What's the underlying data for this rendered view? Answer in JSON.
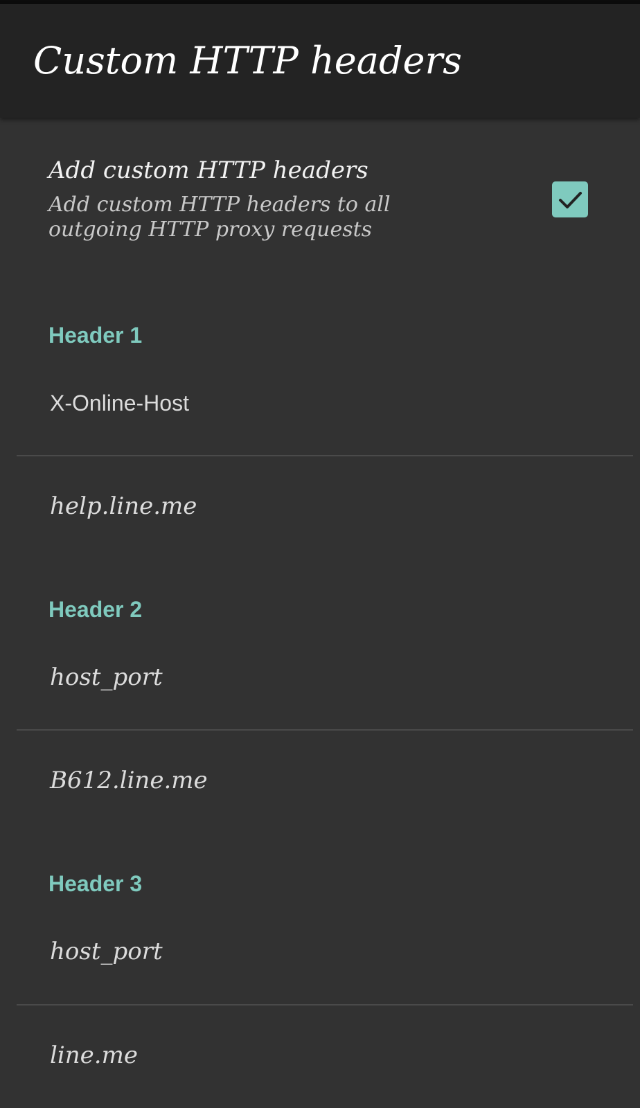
{
  "app_bar": {
    "title": "Custom HTTP headers"
  },
  "toggle": {
    "title": "Add custom HTTP headers",
    "summary": "Add custom HTTP headers to all outgoing HTTP proxy requests",
    "checked": true
  },
  "headers": [
    {
      "category": "Header 1",
      "name": "X-Online-Host",
      "value": "help.line.me"
    },
    {
      "category": "Header 2",
      "name": "host_port",
      "value": "B612.line.me"
    },
    {
      "category": "Header 3",
      "name": "host_port",
      "value": "line.me"
    }
  ],
  "colors": {
    "accent": "#7fcabe",
    "background": "#323232",
    "app_bar": "#232323"
  }
}
